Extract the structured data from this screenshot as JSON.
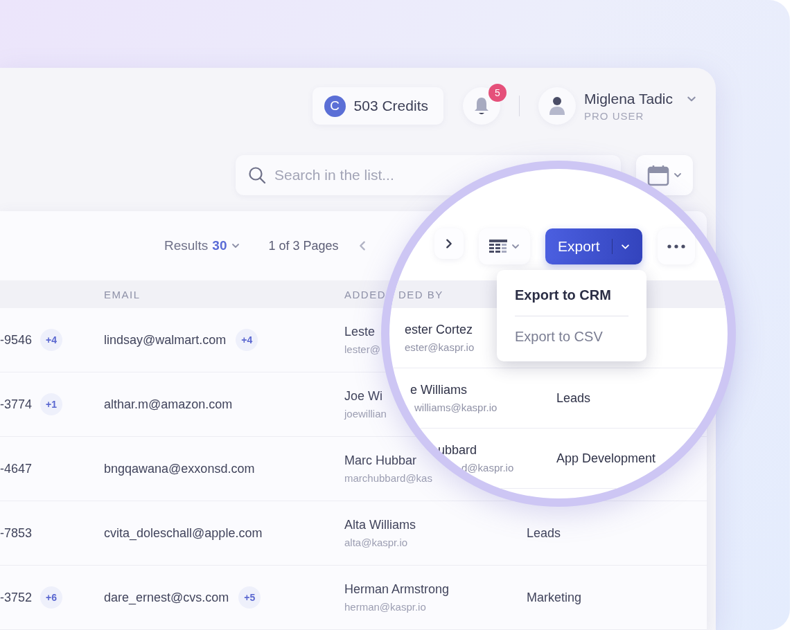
{
  "header": {
    "credits": {
      "icon_letter": "C",
      "label": "503 Credits"
    },
    "notifications": {
      "count": "5"
    },
    "user": {
      "name": "Miglena Tadic",
      "role": "PRO USER"
    }
  },
  "search": {
    "placeholder": "Search in the list..."
  },
  "toolbar": {
    "results_label": "Results",
    "results_count": "30",
    "pages": "1 of 3 Pages"
  },
  "table": {
    "columns": [
      "EMAIL",
      "ADDED"
    ],
    "rows": [
      {
        "phone": "-9546",
        "phone_extra": "+4",
        "email": "lindsay@walmart.com",
        "email_extra": "+4",
        "added_by_name": "Leste",
        "added_by_email": "lester@"
      },
      {
        "phone": "-3774",
        "phone_extra": "+1",
        "email": "althar.m@amazon.com",
        "added_by_name": "Joe Wi",
        "added_by_email": "joewillian"
      },
      {
        "phone": "-4647",
        "email": "bngqawana@exxonsd.com",
        "added_by_name": "Marc Hubbar",
        "added_by_email": "marchubbard@kas"
      },
      {
        "phone": "-7853",
        "email": "cvita_doleschall@apple.com",
        "added_by_name": "Alta Williams",
        "added_by_email": "alta@kaspr.io",
        "list": "Leads"
      },
      {
        "phone": "-3752",
        "phone_extra": "+6",
        "email": "dare_ernest@cvs.com",
        "email_extra": "+5",
        "added_by_name": "Herman Armstrong",
        "added_by_email": "herman@kaspr.io",
        "list": "Marketing"
      }
    ]
  },
  "magnifier": {
    "export_label": "Export",
    "column": "DED BY",
    "rows": [
      {
        "name": "ester Cortez",
        "email": "ester@kaspr.io"
      },
      {
        "name": "e Williams",
        "email": "williams@kaspr.io",
        "list": "Leads"
      },
      {
        "name": "ubbard",
        "email": "d@kaspr.io",
        "list": "App Development"
      }
    ],
    "menu": [
      {
        "label": "Export to CRM",
        "selected": true
      },
      {
        "label": "Export to CSV",
        "selected": false
      }
    ]
  }
}
